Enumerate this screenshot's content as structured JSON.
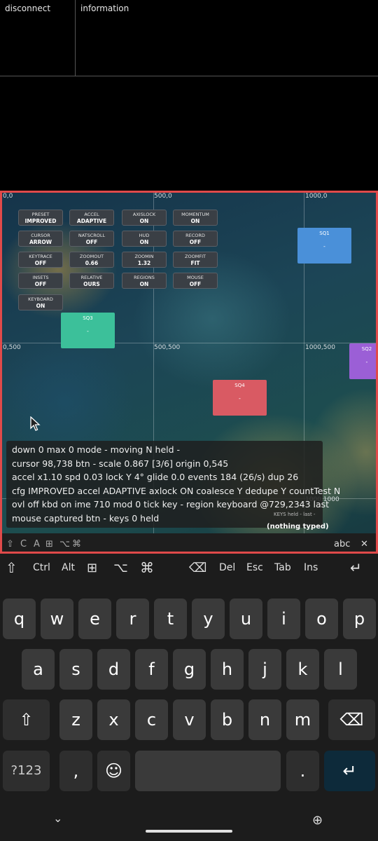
{
  "top": {
    "disconnect": "disconnect",
    "information": "information"
  },
  "coords": {
    "c00": "0,0",
    "c500_0": "500,0",
    "c1000_0": "1000,0",
    "c0_500": "0,500",
    "c500_500": "500,500",
    "c1000_500": "1000,500",
    "c1000_1000": "1000,1000"
  },
  "buttons": [
    {
      "label": "PRESET",
      "value": "IMPROVED"
    },
    {
      "label": "ACCEL",
      "value": "ADAPTIVE"
    },
    {
      "label": "AXISLOCK",
      "value": "ON"
    },
    {
      "label": "MOMENTUM",
      "value": "ON"
    },
    {
      "label": "CURSOR",
      "value": "ARROW"
    },
    {
      "label": "NATSCROLL",
      "value": "OFF"
    },
    {
      "label": "HUD",
      "value": "ON"
    },
    {
      "label": "RECORD",
      "value": "OFF"
    },
    {
      "label": "KEYTRACE",
      "value": "OFF"
    },
    {
      "label": "ZOOMOUT",
      "value": "0.66"
    },
    {
      "label": "ZOOMIN",
      "value": "1.32"
    },
    {
      "label": "ZOOMFIT",
      "value": "FIT"
    },
    {
      "label": "INSETS",
      "value": "OFF"
    },
    {
      "label": "RELATIVE",
      "value": "OURS"
    },
    {
      "label": "REGIONS",
      "value": "ON"
    },
    {
      "label": "MOUSE",
      "value": "OFF"
    },
    {
      "label": "KEYBOARD",
      "value": "ON"
    }
  ],
  "squares": {
    "sq1": {
      "name": "SQ1",
      "value": "-",
      "color": "#4a90d9"
    },
    "sq2": {
      "name": "SQ2",
      "value": "-",
      "color": "#9b5fd6"
    },
    "sq3": {
      "name": "SQ3",
      "value": "-",
      "color": "#3cc09a"
    },
    "sq4": {
      "name": "SQ4",
      "value": "-",
      "color": "#d95a63"
    }
  },
  "status": {
    "line1": "down 0  max 0  mode -  moving N  held -",
    "line2": "cursor 98,738  btn -  scale 0.867 [3/6]  origin 0,545",
    "line3": "accel x1.10  spd 0.03  lock Y 4°  glide 0.0  events 184 (26/s)  dup 26",
    "line4": "cfg IMPROVED  accel ADAPTIVE  axlock ON  coalesce Y  dedupe Y  countTest N",
    "line5": "ovl off   kbd on ime 710 mod 0 tick   key -   region keyboard @729,2343   last",
    "line6": "mouse captured btn -   keys 0 held"
  },
  "keys_held": "KEYS  held -  last -",
  "nothing_typed": "(nothing typed)",
  "hud": {
    "abc": "abc"
  },
  "keyboard": {
    "toolbar": {
      "ctrl": "Ctrl",
      "alt": "Alt",
      "del": "Del",
      "esc": "Esc",
      "tab": "Tab",
      "ins": "Ins"
    },
    "row1": [
      "q",
      "w",
      "e",
      "r",
      "t",
      "y",
      "u",
      "i",
      "o",
      "p"
    ],
    "row2": [
      "a",
      "s",
      "d",
      "f",
      "g",
      "h",
      "j",
      "k",
      "l"
    ],
    "row3": [
      "z",
      "x",
      "c",
      "v",
      "b",
      "n",
      "m"
    ],
    "sym": "?123",
    "comma": ",",
    "period": "."
  },
  "accent": "#e04a4a"
}
